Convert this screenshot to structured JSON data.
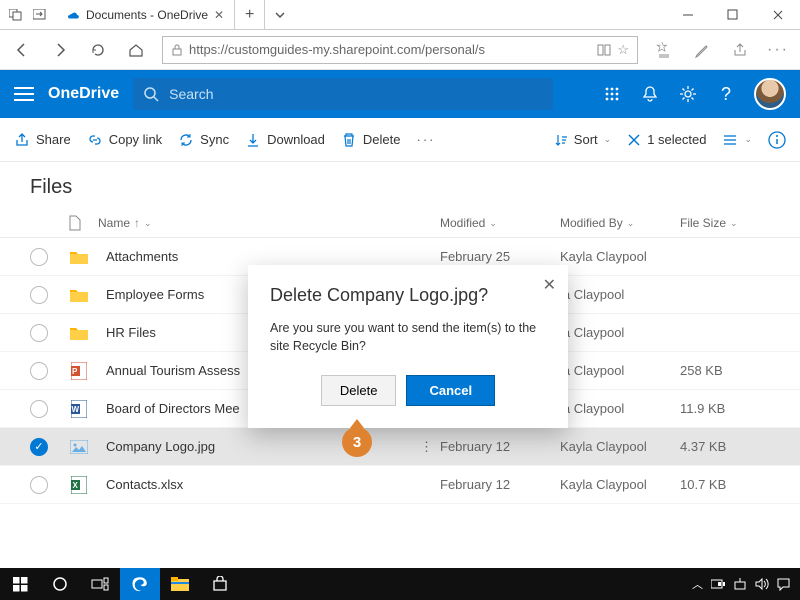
{
  "window": {
    "tab_title": "Documents - OneDrive",
    "url": "https://customguides-my.sharepoint.com/personal/s"
  },
  "header": {
    "brand": "OneDrive",
    "search_placeholder": "Search"
  },
  "commands": {
    "share": "Share",
    "copylink": "Copy link",
    "sync": "Sync",
    "download": "Download",
    "delete": "Delete",
    "sort": "Sort",
    "selected": "1 selected"
  },
  "breadcrumb": "Files",
  "columns": {
    "name": "Name",
    "modified": "Modified",
    "modified_by": "Modified By",
    "size": "File Size"
  },
  "rows": [
    {
      "type": "folder",
      "name": "Attachments",
      "modified": "February 25",
      "by": "Kayla Claypool",
      "size": ""
    },
    {
      "type": "folder",
      "name": "Employee Forms",
      "modified": "",
      "by": "la Claypool",
      "size": ""
    },
    {
      "type": "folder",
      "name": "HR Files",
      "modified": "",
      "by": "la Claypool",
      "size": ""
    },
    {
      "type": "ppt",
      "name": "Annual Tourism Assess",
      "modified": "",
      "by": "la Claypool",
      "size": "258 KB"
    },
    {
      "type": "word",
      "name": "Board of Directors Mee",
      "modified": "",
      "by": "la Claypool",
      "size": "11.9 KB"
    },
    {
      "type": "image",
      "name": "Company Logo.jpg",
      "modified": "February 12",
      "by": "Kayla Claypool",
      "size": "4.37 KB",
      "selected": true
    },
    {
      "type": "excel",
      "name": "Contacts.xlsx",
      "modified": "February 12",
      "by": "Kayla Claypool",
      "size": "10.7 KB"
    }
  ],
  "dialog": {
    "title": "Delete Company Logo.jpg?",
    "body": "Are you sure you want to send the item(s) to the site Recycle Bin?",
    "delete": "Delete",
    "cancel": "Cancel"
  },
  "callout": "3"
}
